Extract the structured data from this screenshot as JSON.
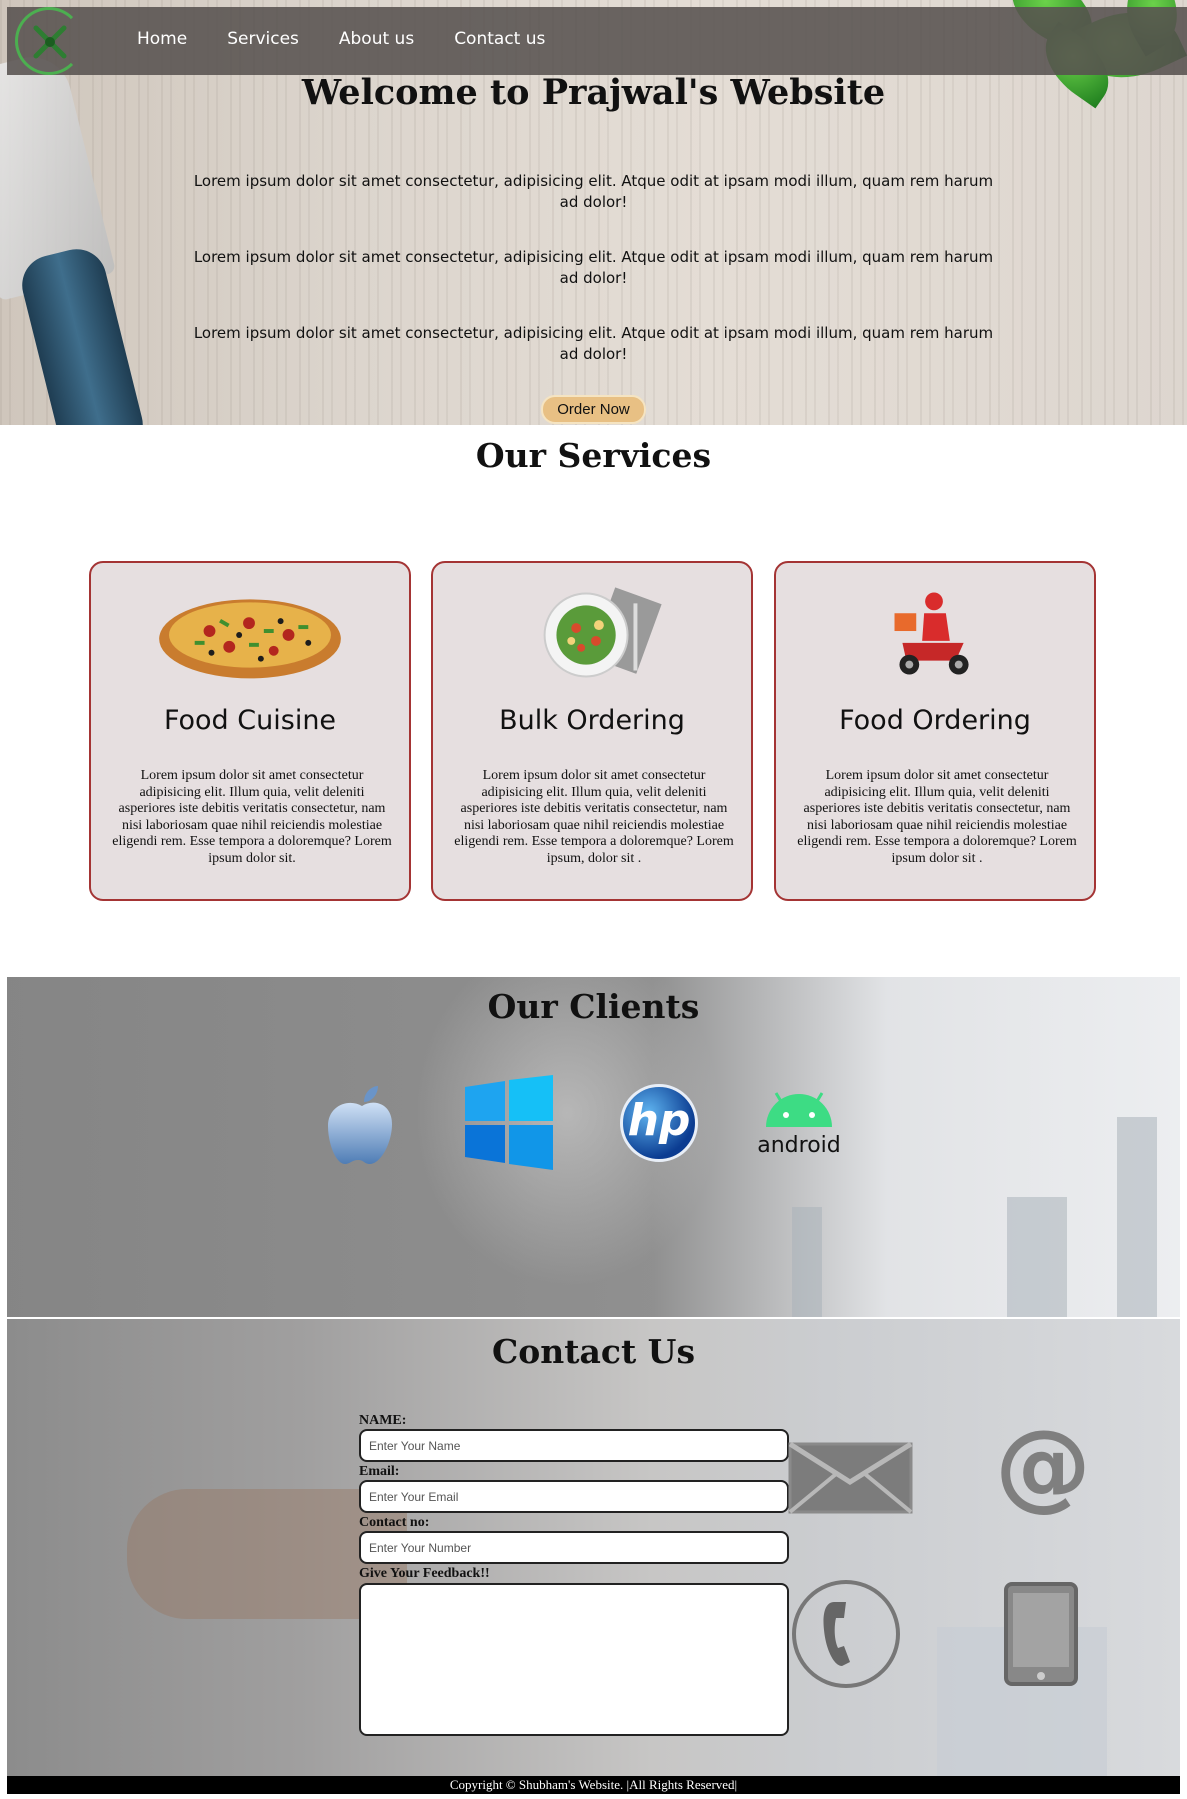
{
  "nav": {
    "items": [
      {
        "label": "Home"
      },
      {
        "label": "Services"
      },
      {
        "label": "About us"
      },
      {
        "label": "Contact us"
      }
    ]
  },
  "hero": {
    "title": "Welcome to Prajwal's Website",
    "paragraphs": [
      "Lorem ipsum dolor sit amet consectetur, adipisicing elit. Atque odit at ipsam modi illum, quam rem harum ad dolor!",
      "Lorem ipsum dolor sit amet consectetur, adipisicing elit. Atque odit at ipsam modi illum, quam rem harum ad dolor!",
      "Lorem ipsum dolor sit amet consectetur, adipisicing elit. Atque odit at ipsam modi illum, quam rem harum ad dolor!"
    ],
    "button_label": "Order Now"
  },
  "services": {
    "title": "Our Services",
    "cards": [
      {
        "title": "Food Cuisine",
        "image": "pizza-image",
        "text": "Lorem ipsum dolor sit amet consectetur adipisicing elit. Illum quia, velit deleniti asperiores iste debitis veritatis consectetur, nam nisi laboriosam quae nihil reiciendis molestiae eligendi rem. Esse tempora a doloremque? Lorem ipsum dolor sit."
      },
      {
        "title": "Bulk Ordering",
        "image": "salad-plate-image",
        "text": "Lorem ipsum dolor sit amet consectetur adipisicing elit. Illum quia, velit deleniti asperiores iste debitis veritatis consectetur, nam nisi laboriosam quae nihil reiciendis molestiae eligendi rem. Esse tempora a doloremque? Lorem ipsum, dolor sit ."
      },
      {
        "title": "Food Ordering",
        "image": "delivery-scooter-image",
        "text": "Lorem ipsum dolor sit amet consectetur adipisicing elit. Illum quia, velit deleniti asperiores iste debitis veritatis consectetur, nam nisi laboriosam quae nihil reiciendis molestiae eligendi rem. Esse tempora a doloremque? Lorem ipsum dolor sit ."
      }
    ]
  },
  "clients": {
    "title": "Our Clients",
    "logos": [
      "apple-logo",
      "windows-logo",
      "hp-logo",
      "android-logo"
    ],
    "hp_text": "hp",
    "android_text": "android"
  },
  "contact": {
    "title": "Contact Us",
    "name_label": "NAME:",
    "name_placeholder": "Enter Your Name",
    "email_label": "Email:",
    "email_placeholder": "Enter Your Email",
    "phone_label": "Contact no:",
    "phone_placeholder": "Enter Your Number",
    "feedback_label": "Give Your Feedback!!",
    "icons": [
      "envelope-icon",
      "at-sign-icon",
      "phone-icon",
      "tablet-icon"
    ],
    "at_symbol": "@"
  },
  "footer": {
    "text": "Copyright © Shubham's Website. |All Rights Reserved|"
  },
  "colors": {
    "nav_bg": "#585250",
    "button_bg": "#e8c084",
    "card_bg": "#e6dfe0",
    "card_border": "#a43434",
    "footer_bg": "#000000"
  }
}
